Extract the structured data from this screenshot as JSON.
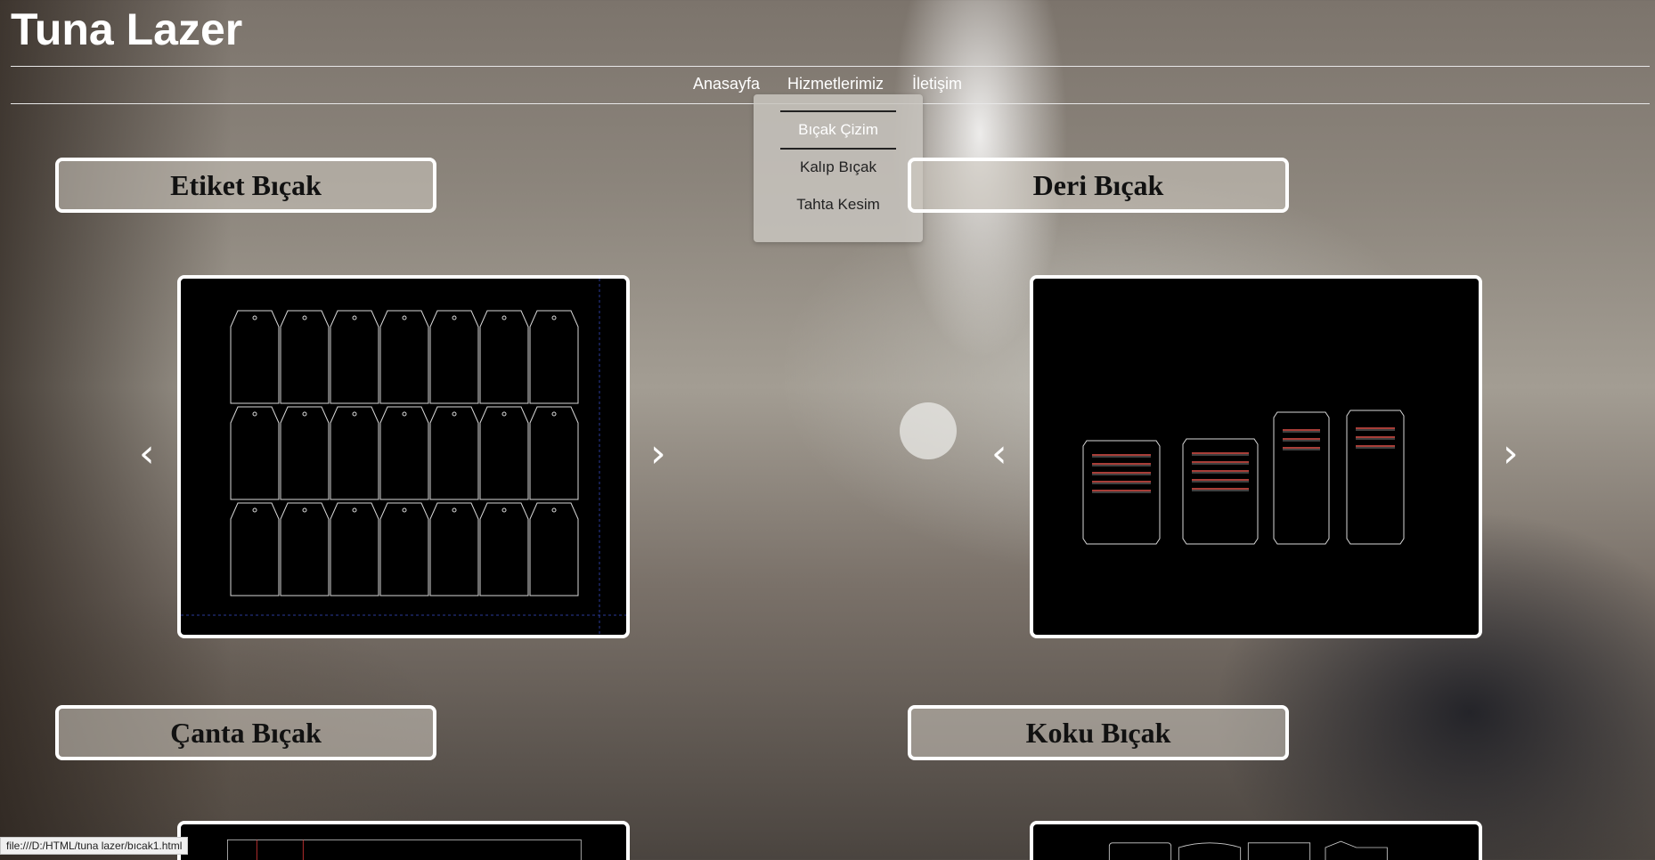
{
  "site": {
    "title": "Tuna Lazer"
  },
  "nav": {
    "items": [
      {
        "label": "Anasayfa"
      },
      {
        "label": "Hizmetlerimiz"
      },
      {
        "label": "İletişim"
      }
    ],
    "dropdown": {
      "items": [
        {
          "label": "Bıçak Çizim",
          "active": true
        },
        {
          "label": "Kalıp Bıçak",
          "active": false
        },
        {
          "label": "Tahta Kesim",
          "active": false
        }
      ]
    }
  },
  "categories": [
    {
      "title": "Etiket Bıçak"
    },
    {
      "title": "Deri Bıçak"
    },
    {
      "title": "Çanta Bıçak"
    },
    {
      "title": "Koku Bıçak"
    }
  ],
  "carousel": {
    "prev_icon": "‹",
    "next_icon": "›"
  },
  "status_bar": {
    "url": "file:///D:/HTML/tuna lazer/bıcak1.html"
  },
  "colors": {
    "frame_border": "#ffffff",
    "frame_bg": "#000000",
    "stitch": "#e0524a"
  }
}
